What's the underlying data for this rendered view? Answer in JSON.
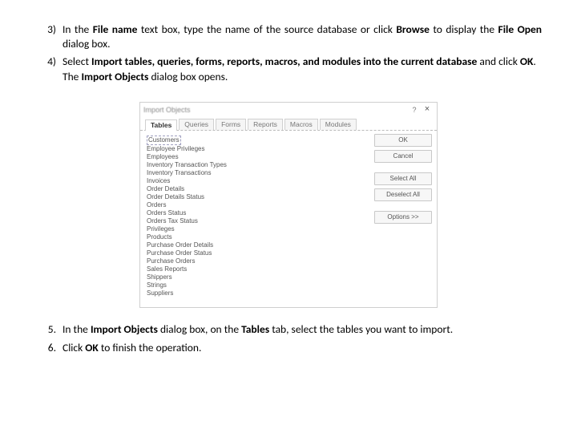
{
  "steps_paren": {
    "s3": {
      "num": "3)",
      "lead": "In the ",
      "b1": "File name",
      "mid1": " text box, type the name of the source database or click ",
      "b2": "Browse",
      "mid2": " to display the ",
      "b3": "File Open",
      "tail": " dialog box."
    },
    "s4": {
      "num": "4)",
      "lead": "Select ",
      "b1": "Import tables, queries, forms, reports, macros, and modules into the current database",
      "mid1": " and click ",
      "b2": "OK",
      "mid2": ". The ",
      "b3": "Import Objects",
      "tail": " dialog box opens."
    }
  },
  "dialog": {
    "title": "Import Objects",
    "help": "?",
    "close": "×",
    "tabs": [
      "Tables",
      "Queries",
      "Forms",
      "Reports",
      "Macros",
      "Modules"
    ],
    "list": [
      "Customers",
      "Employee Privileges",
      "Employees",
      "Inventory Transaction Types",
      "Inventory Transactions",
      "Invoices",
      "Order Details",
      "Order Details Status",
      "Orders",
      "Orders Status",
      "Orders Tax Status",
      "Privileges",
      "Products",
      "Purchase Order Details",
      "Purchase Order Status",
      "Purchase Orders",
      "Sales Reports",
      "Shippers",
      "Strings",
      "Suppliers"
    ],
    "buttons": {
      "ok": "OK",
      "cancel": "Cancel",
      "select_all": "Select All",
      "deselect_all": "Deselect All",
      "options": "Options >>"
    }
  },
  "steps_dot": {
    "s5": {
      "num": "5.",
      "lead": "In the ",
      "b1": "Import Objects",
      "mid1": " dialog box, on the ",
      "b2": "Tables",
      "tail": " tab, select the tables you want to import."
    },
    "s6": {
      "num": "6.",
      "lead": "Click ",
      "b1": "OK",
      "tail": " to finish the operation."
    }
  }
}
